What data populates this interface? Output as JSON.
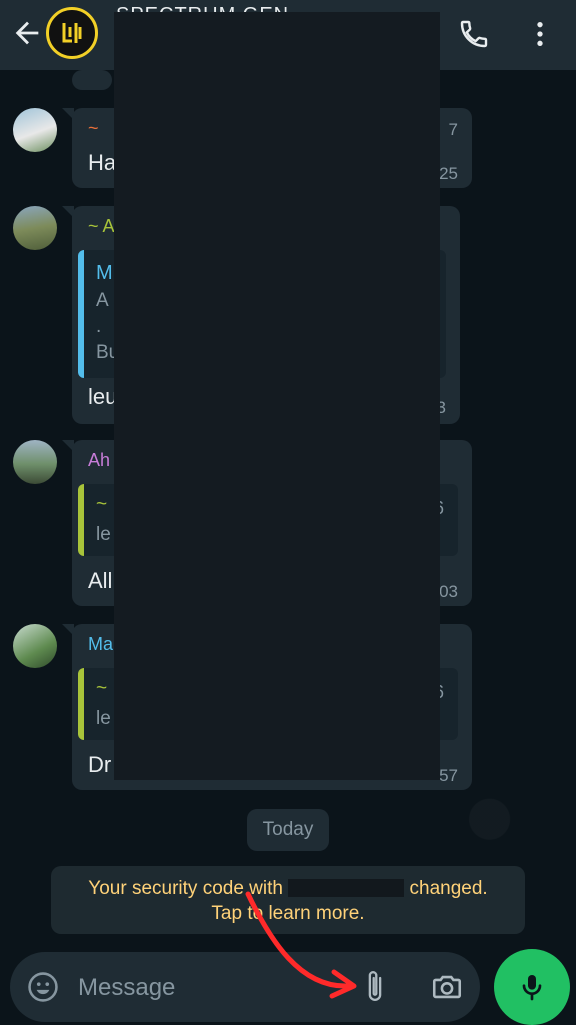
{
  "header": {
    "group_name": "SPECTRUM GEN"
  },
  "messages": [
    {
      "sender": "~ ",
      "text": "Ha",
      "quote_time": "",
      "time": "25",
      "extra": "7"
    },
    {
      "sender": "~ A",
      "quote_sender": "M",
      "quote_lines": [
        "A",
        ".",
        "Bu"
      ],
      "text": "leu",
      "time": "3"
    },
    {
      "sender": "Ah",
      "quote_sender": "~",
      "quote_text": "le",
      "quote_time": "6",
      "text": "All",
      "time": "03"
    },
    {
      "sender": "Ma",
      "quote_sender": "~",
      "quote_text": "le",
      "quote_time": "6",
      "text": "Dr",
      "time": "57"
    }
  ],
  "date_divider": "Today",
  "system_message": {
    "part1": "Your security code with",
    "part2": "changed.",
    "line2": "Tap to learn more."
  },
  "composer": {
    "placeholder": "Message"
  },
  "colors": {
    "accent_green": "#21c063",
    "bubble": "#1f2c34",
    "system_text": "#ffd279"
  }
}
